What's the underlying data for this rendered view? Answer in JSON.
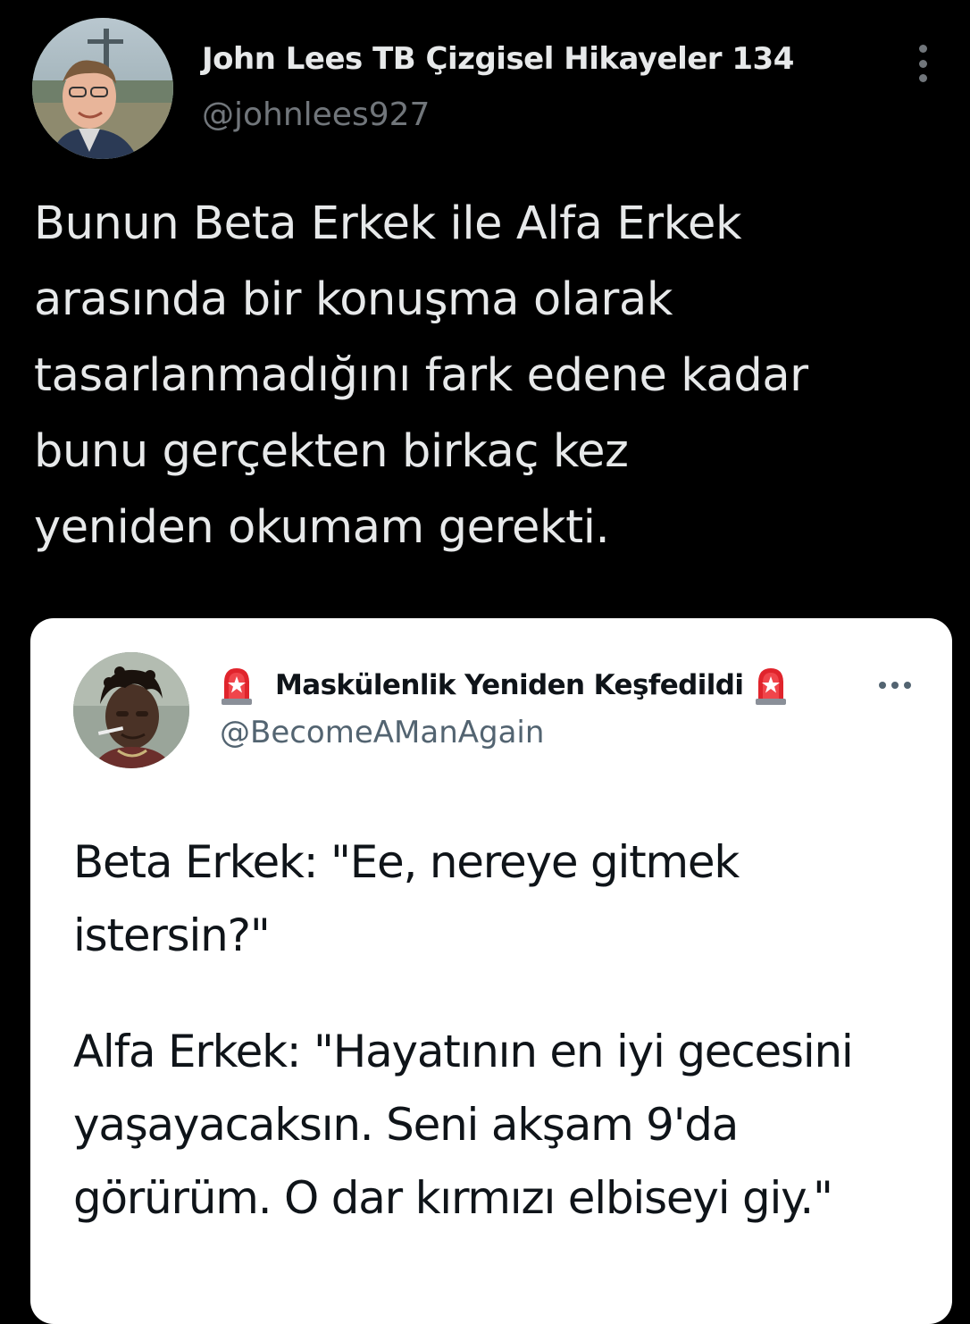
{
  "outer_tweet": {
    "display_name": "John Lees TB Çizgisel Hikayeler 134",
    "handle": "@johnlees927",
    "text_lines": [
      "Bunun Beta Erkek ile Alfa Erkek",
      "arasında bir konuşma olarak",
      "tasarlanmadığını fark edene kadar",
      "bunu gerçekten birkaç kez",
      "yeniden okumam gerekti."
    ],
    "more_icon": "vertical-ellipsis-icon"
  },
  "quoted_tweet": {
    "display_name": "Maskülenlik Yeniden Keşfedildi",
    "handle": "@BecomeAManAgain",
    "name_icons": [
      "siren-icon",
      "siren-icon"
    ],
    "more_icon": "horizontal-ellipsis-icon",
    "paragraphs": [
      {
        "lines": [
          "Beta Erkek: \"Ee, nereye gitmek",
          "istersin?\""
        ]
      },
      {
        "lines": [
          "Alfa Erkek: \"Hayatının en iyi gecesini",
          "yaşayacaksın. Seni akşam 9'da",
          "görürüm. O dar kırmızı elbiseyi giy.\""
        ]
      }
    ]
  },
  "colors": {
    "background": "#000000",
    "card_background": "#ffffff",
    "primary_text_dark": "#e7e9ea",
    "secondary_text_dark": "#71767b",
    "primary_text_light": "#0f1419",
    "secondary_text_light": "#536471",
    "siren_red": "#e0242c"
  }
}
